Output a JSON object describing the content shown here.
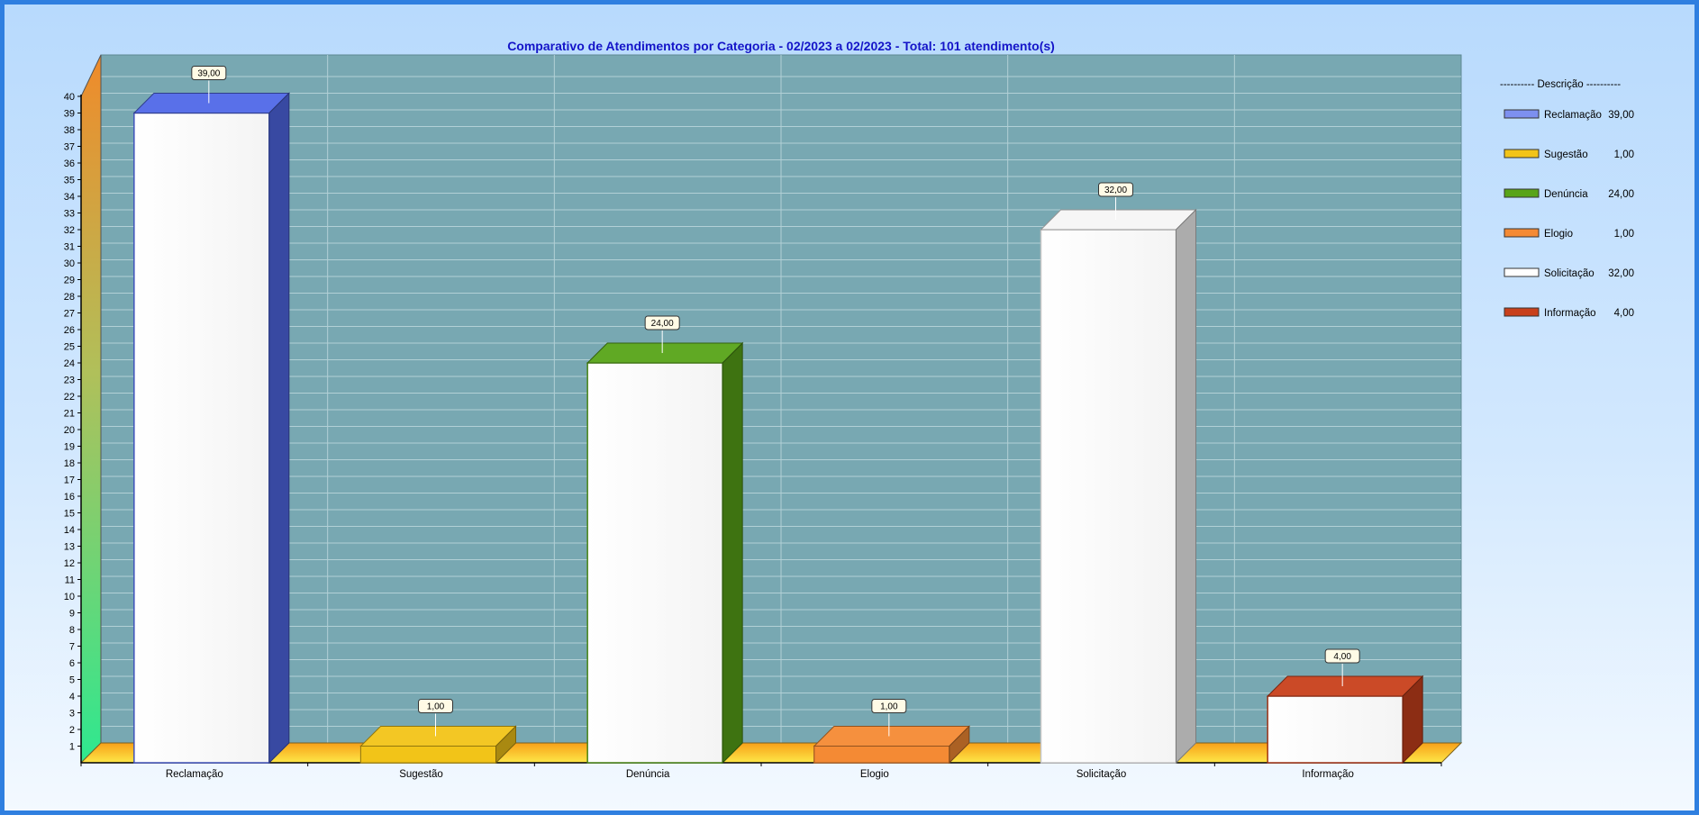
{
  "chart_data": {
    "type": "bar",
    "title": "Comparativo de Atendimentos por Categoria - 02/2023 a 02/2023 - Total: 101 atendimento(s)",
    "categories": [
      "Reclamação",
      "Sugestão",
      "Denúncia",
      "Elogio",
      "Solicitação",
      "Informação"
    ],
    "values": [
      39,
      1,
      24,
      1,
      32,
      4
    ],
    "data_labels": [
      "39,00",
      "1,00",
      "24,00",
      "1,00",
      "32,00",
      "4,00"
    ],
    "colors": [
      "#5068e8",
      "#f2c418",
      "#58a418",
      "#f48a34",
      "#f6f6f6",
      "#c8401c"
    ],
    "ylim": [
      0,
      40
    ],
    "yticks": [
      1,
      2,
      3,
      4,
      5,
      6,
      7,
      8,
      9,
      10,
      11,
      12,
      13,
      14,
      15,
      16,
      17,
      18,
      19,
      20,
      21,
      22,
      23,
      24,
      25,
      26,
      27,
      28,
      29,
      30,
      31,
      32,
      33,
      34,
      35,
      36,
      37,
      38,
      39,
      40
    ],
    "grid": true,
    "legend": {
      "placement": "right",
      "header": "---------- Descrição ----------",
      "items": [
        {
          "label": "Reclamação",
          "value": "39,00",
          "color": "#7d90f0"
        },
        {
          "label": "Sugestão",
          "value": "1,00",
          "color": "#f2c418"
        },
        {
          "label": "Denúncia",
          "value": "24,00",
          "color": "#58a418"
        },
        {
          "label": "Elogio",
          "value": "1,00",
          "color": "#f48a34"
        },
        {
          "label": "Solicitação",
          "value": "32,00",
          "color": "#ffffff"
        },
        {
          "label": "Informação",
          "value": "4,00",
          "color": "#c8401c"
        }
      ]
    }
  }
}
